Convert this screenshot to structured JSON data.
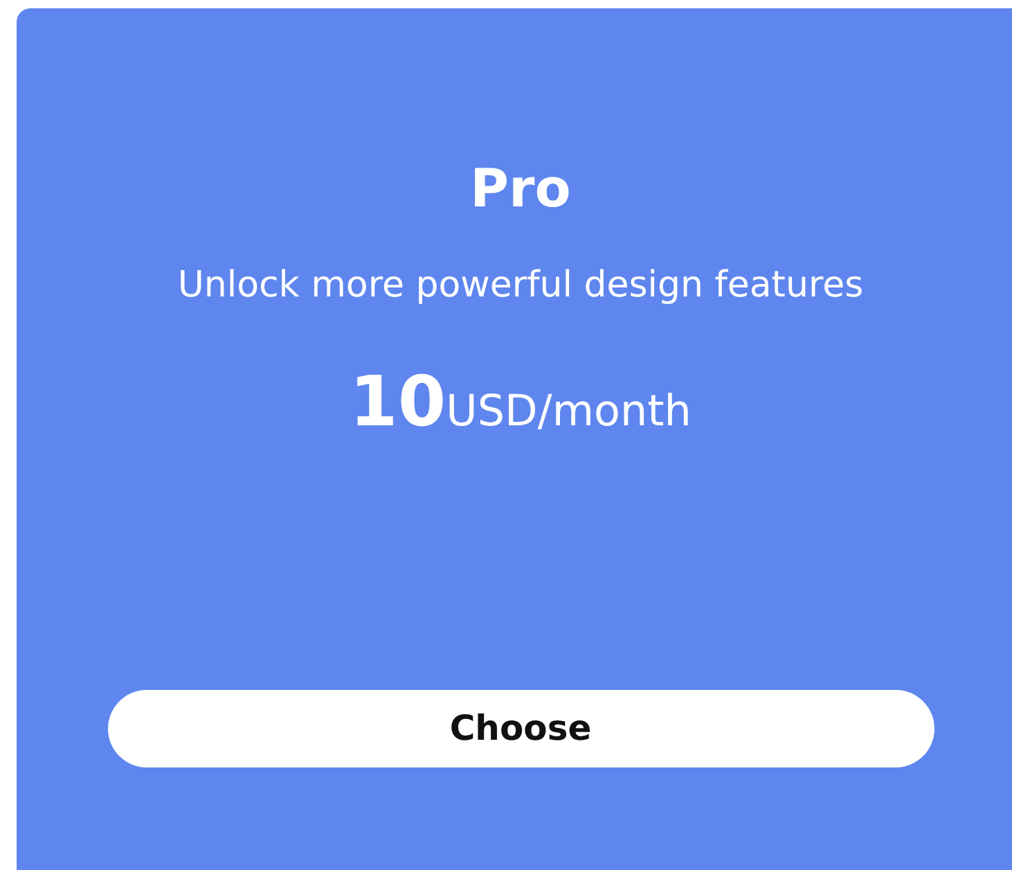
{
  "plan": {
    "title": "Pro",
    "description": "Unlock more powerful design features",
    "price": {
      "amount": "10",
      "unit": "USD/month"
    },
    "button": "Choose"
  }
}
